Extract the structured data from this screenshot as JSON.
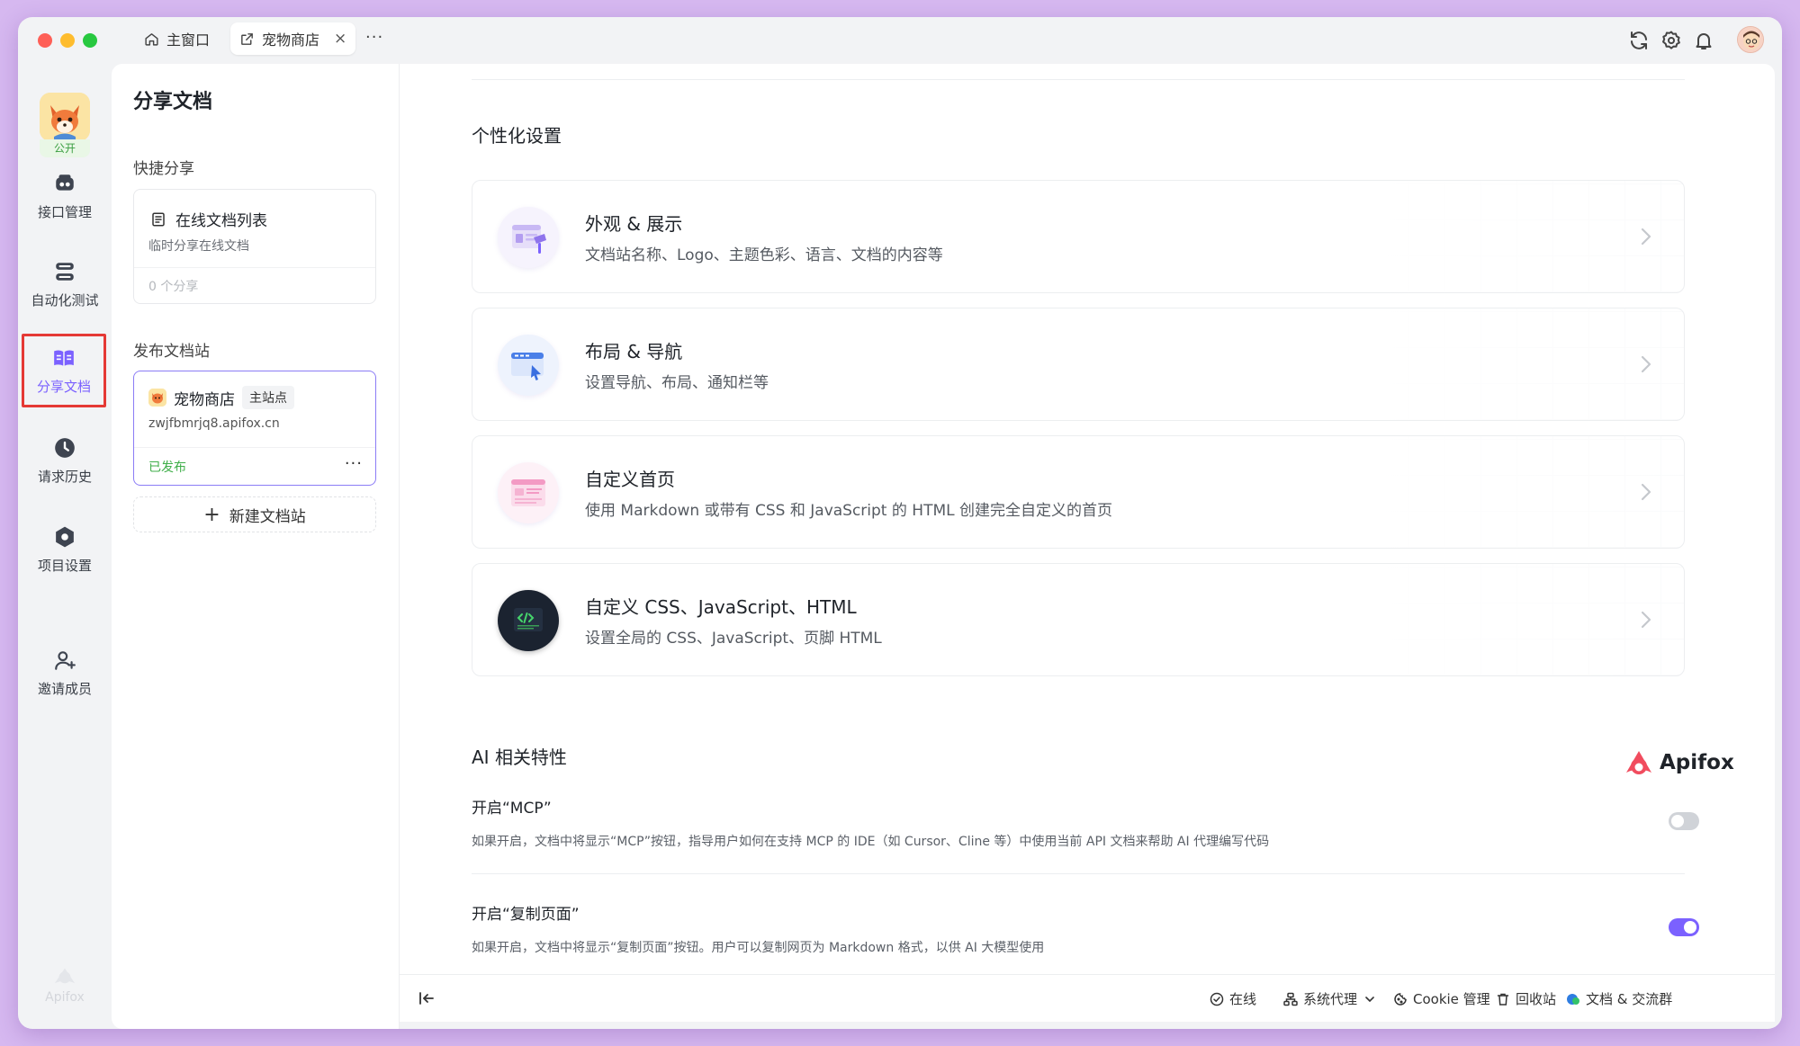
{
  "titlebar": {
    "tabs": [
      {
        "label": "主窗口",
        "icon": "home-icon",
        "active": false
      },
      {
        "label": "宠物商店",
        "icon": "share-link-icon",
        "active": true
      }
    ],
    "more": "···",
    "close": "×"
  },
  "rail": {
    "project_badge": "公开",
    "items": [
      {
        "label": "接口管理",
        "icon": "api-management-icon"
      },
      {
        "label": "自动化测试",
        "icon": "automation-test-icon"
      },
      {
        "label": "分享文档",
        "icon": "share-docs-icon",
        "active": true
      },
      {
        "label": "请求历史",
        "icon": "history-icon"
      },
      {
        "label": "项目设置",
        "icon": "project-settings-icon"
      },
      {
        "label": "邀请成员",
        "icon": "invite-member-icon"
      }
    ],
    "brand": "Apifox"
  },
  "panel": {
    "title": "分享文档",
    "quick_share_label": "快捷分享",
    "online_card": {
      "title": "在线文档列表",
      "desc": "临时分享在线文档",
      "count": "0 个分享"
    },
    "publish_label": "发布文档站",
    "site_card": {
      "name": "宠物商店",
      "tag": "主站点",
      "url": "zwjfbmrjq8.apifox.cn",
      "status": "已发布",
      "more": "···"
    },
    "new_site": "新建文档站",
    "new_site_plus": "+"
  },
  "main": {
    "personal_heading": "个性化设置",
    "features": [
      {
        "title": "外观 & 展示",
        "desc": "文档站名称、Logo、主题色彩、语言、文档的内容等",
        "icon": "appearance-icon"
      },
      {
        "title": "布局 & 导航",
        "desc": "设置导航、布局、通知栏等",
        "icon": "layout-navigation-icon"
      },
      {
        "title": "自定义首页",
        "desc": "使用 Markdown 或带有 CSS 和 JavaScript 的 HTML 创建完全自定义的首页",
        "icon": "custom-homepage-icon"
      },
      {
        "title": "自定义 CSS、JavaScript、HTML",
        "desc": "设置全局的 CSS、JavaScript、页脚 HTML",
        "icon": "code-icon"
      }
    ],
    "ai_heading": "AI 相关特性",
    "brand": "Apifox",
    "ai_settings": [
      {
        "title": "开启“MCP”",
        "desc": "如果开启，文档中将显示“MCP”按钮，指导用户如何在支持 MCP 的 IDE（如 Cursor、Cline 等）中使用当前 API 文档来帮助 AI 代理编写代码",
        "enabled": false
      },
      {
        "title": "开启“复制页面”",
        "desc": "如果开启，文档中将显示“复制页面”按钮。用户可以复制网页为 Markdown 格式，以供 AI 大模型使用",
        "enabled": true
      }
    ]
  },
  "statusbar": {
    "online": "在线",
    "proxy": "系统代理",
    "cookie": "Cookie 管理",
    "trash": "回收站",
    "docs": "文档 & 交流群"
  },
  "colors": {
    "accent": "#7b61ff",
    "highlight_border": "#e53935",
    "published_green": "#3fae49"
  }
}
